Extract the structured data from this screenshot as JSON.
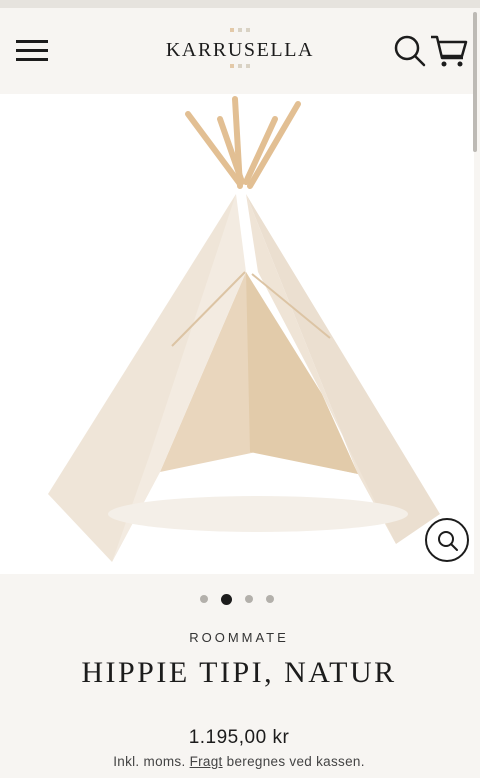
{
  "header": {
    "logo_text": "KARRUSELLA",
    "logo_dot_colors": [
      "#e3c9a8",
      "#d9d2c4",
      "#d9d2c4"
    ]
  },
  "product": {
    "vendor": "ROOMMATE",
    "title": "HIPPIE TIPI, NATUR",
    "price": "1.195,00 kr",
    "tax_prefix": "Inkl. moms.",
    "shipping_link": "Fragt",
    "tax_suffix": "beregnes ved kassen."
  },
  "carousel": {
    "slide_count": 4,
    "active_index": 1
  },
  "icons": {
    "menu": "hamburger-icon",
    "search": "search-icon",
    "cart": "cart-icon",
    "zoom": "zoom-icon"
  },
  "colors": {
    "background": "#f7f5f2",
    "text": "#1c1c1c",
    "tent_canvas": "#f1e6d8",
    "tent_poles": "#e7c49a"
  }
}
